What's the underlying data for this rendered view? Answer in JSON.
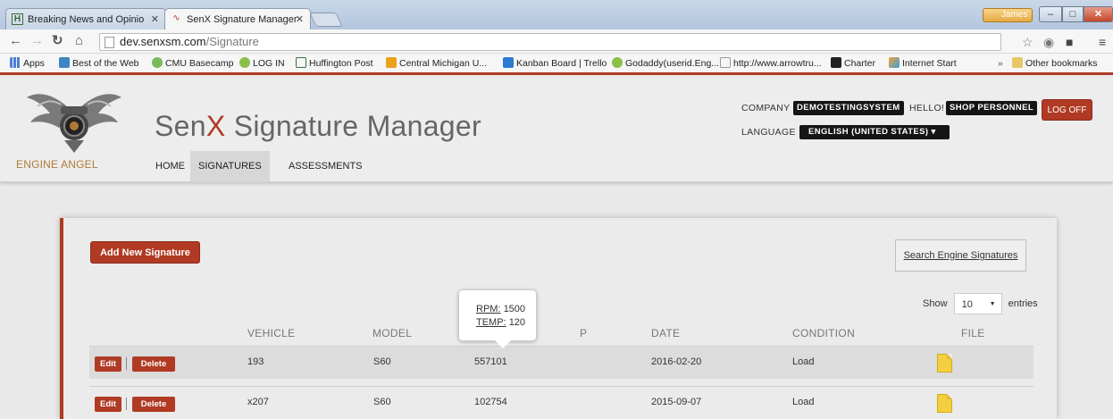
{
  "browser": {
    "tabs": [
      {
        "label": "Breaking News and Opinio",
        "favicon": "H"
      },
      {
        "label": "SenX Signature Manager",
        "favicon": "signature-icon"
      }
    ],
    "user": "James",
    "url_host": "dev.senxsm.com",
    "url_path": "/Signature",
    "bookmarks": [
      "Apps",
      "Best of the Web",
      "CMU Basecamp",
      "LOG IN",
      "Huffington Post",
      "Central Michigan U...",
      "Kanban Board | Trello",
      "Godaddy(userid.Eng...",
      "http://www.arrowtru...",
      "Charter",
      "Internet Start"
    ],
    "bookmarks_overflow": "»",
    "other_bookmarks": "Other bookmarks"
  },
  "site": {
    "logo_caption": "ENGINE ANGEL",
    "title_prefix": "Sen",
    "title_accent": "X",
    "title_suffix": " Signature Manager",
    "nav": [
      "HOME",
      "SIGNATURES",
      "ASSESSMENTS"
    ],
    "company_label": "COMPANY",
    "company_value": "DEMOTESTINGSYSTEM",
    "hello_label": "HELLO!",
    "user_role": "SHOP PERSONNEL",
    "language_label": "LANGUAGE",
    "language_value": "ENGLISH (UNITED STATES)",
    "logoff_label": "LOG OFF",
    "accent_color": "#b03a23"
  },
  "panel": {
    "add_button": "Add New Signature",
    "search_link": "Search Engine Signatures",
    "show_label": "Show",
    "show_value": "10",
    "entries_label": "entries",
    "columns": [
      "VEHICLE",
      "MODEL",
      "P",
      "DATE",
      "CONDITION",
      "FILE"
    ],
    "edit_label": "Edit",
    "delete_label": "Delete",
    "rows": [
      {
        "vehicle": "193",
        "model": "S60",
        "p": "557101",
        "date": "2016-02-20",
        "condition": "Load"
      },
      {
        "vehicle": "x207",
        "model": "S60",
        "p": "102754",
        "date": "2015-09-07",
        "condition": "Load"
      }
    ],
    "tooltip": {
      "rpm_label": "RPM:",
      "rpm_value": "1500",
      "temp_label": "TEMP:",
      "temp_value": "120"
    }
  }
}
